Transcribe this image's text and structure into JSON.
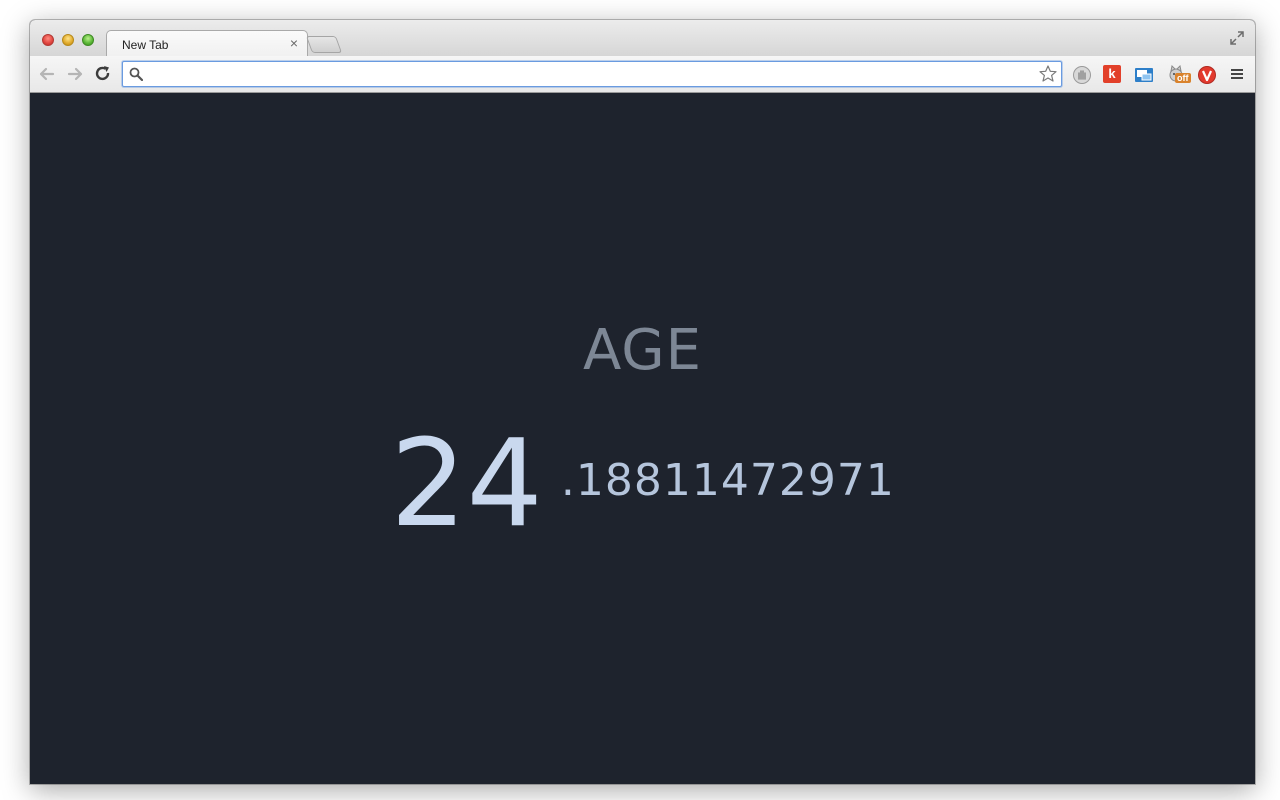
{
  "browser": {
    "tab": {
      "title": "New Tab",
      "close_glyph": "×"
    },
    "omnibox": {
      "value": "",
      "placeholder": ""
    },
    "extensions": [
      {
        "name": "hand-extension-icon"
      },
      {
        "name": "k-extension-icon",
        "label": "k"
      },
      {
        "name": "screenshot-extension-icon"
      },
      {
        "name": "cat-extension-icon",
        "badge": "off"
      },
      {
        "name": "red-v-extension-icon"
      }
    ]
  },
  "page": {
    "heading": "AGE",
    "age_years": "24",
    "age_fraction": ".18811472971"
  },
  "colors": {
    "background": "#1e232d",
    "heading": "#7d8795",
    "years": "#c9d8ee",
    "fraction": "#b5c5dc"
  }
}
